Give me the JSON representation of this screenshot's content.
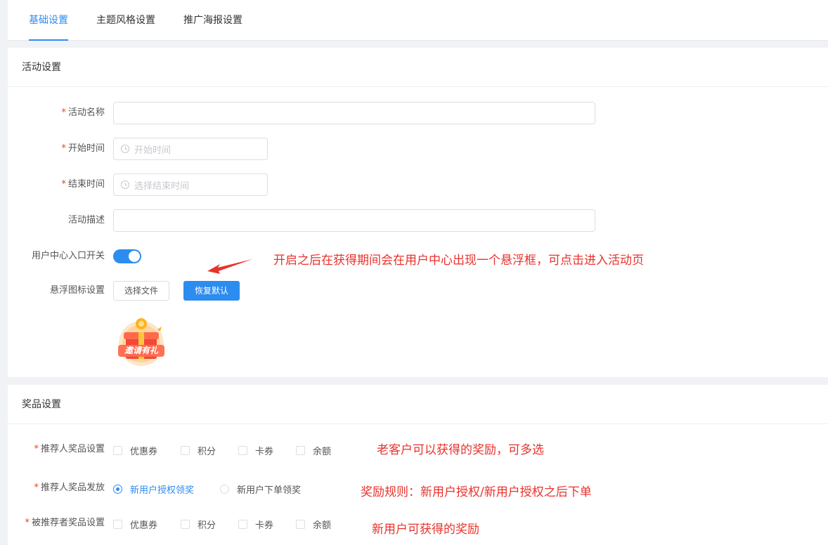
{
  "tabs": [
    "基础设置",
    "主题风格设置",
    "推广海报设置"
  ],
  "activity": {
    "section_title": "活动设置",
    "name_label": "活动名称",
    "start_label": "开始时间",
    "start_placeholder": "开始时间",
    "end_label": "结束时间",
    "end_placeholder": "选择结束时间",
    "desc_label": "活动描述",
    "entry_switch_label": "用户中心入口开关",
    "entry_switch_on": true,
    "icon_label": "悬浮图标设置",
    "choose_file": "选择文件",
    "restore_default": "恢复默认",
    "icon_text": "邀请有礼",
    "note": "开启之后在获得期间会在用户中心出现一个悬浮框，可点击进入活动页"
  },
  "prize": {
    "section_title": "奖品设置",
    "referrer_prize_label": "推荐人奖品设置",
    "referrer_issue_label": "推荐人奖品发放",
    "referee_prize_label": "被推荐者奖品设置",
    "prize_options": [
      "优惠券",
      "积分",
      "卡券",
      "余额"
    ],
    "issue_options": [
      "新用户授权领奖",
      "新用户下单领奖"
    ],
    "issue_selected": "新用户授权领奖",
    "note_referrer": "老客户可以获得的奖励，可多选",
    "note_issue": "奖励规则：新用户授权/新用户授权之后下单",
    "note_referee": "新用户可获得的奖励"
  },
  "colors": {
    "primary": "#2d8cf0",
    "annotation": "#e8322d",
    "required": "#ed4014"
  }
}
